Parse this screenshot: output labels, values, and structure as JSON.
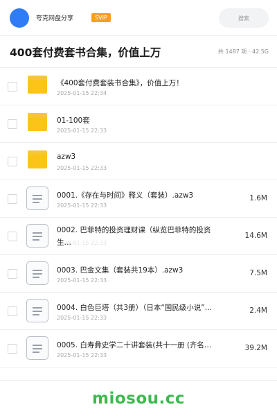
{
  "header": {
    "user_name": "夸克网盘分享",
    "badge": "SVIP",
    "search_placeholder": "搜索"
  },
  "title": "400套付费套书合集，价值上万",
  "meta": "共 1487 项 · 42.5G",
  "files": [
    {
      "type": "folder",
      "name": "《400套付费套装书合集》，价值上万！",
      "date": "2025-01-15 22:34",
      "size": ""
    },
    {
      "type": "folder",
      "name": "01-100套",
      "date": "2025-01-15 22:33",
      "size": ""
    },
    {
      "type": "folder",
      "name": "azw3",
      "date": "2025-01-15 22:33",
      "size": ""
    },
    {
      "type": "file",
      "name": "0001.《存在与时间》释义（套装）.azw3",
      "date": "2025-01-15 22:33",
      "size": "1.6M"
    },
    {
      "type": "file",
      "name": "0002. 巴菲特的投资理财课（纵览巴菲特的投资生…",
      "date": "2025-01-15 22:33",
      "size": "14.6M"
    },
    {
      "type": "file",
      "name": "0003. 巴金文集（套装共19本）.azw3",
      "date": "2025-01-15 22:33",
      "size": "7.5M"
    },
    {
      "type": "file",
      "name": "0004. 白色巨塔（共3册）（日本“国民级小说”…",
      "date": "2025-01-15 22:33",
      "size": "2.4M"
    },
    {
      "type": "file",
      "name": "0005. 白寿彝史学二十讲套装(共十一册 (齐名…",
      "date": "2025-01-15 22:33",
      "size": "39.2M"
    }
  ],
  "footer": {
    "brand": "miosou.cc"
  },
  "colors": {
    "avatar": "#2f7cf6",
    "badge": "#f6a023",
    "folder": "#fcc419",
    "brand": "#3dba4e"
  }
}
